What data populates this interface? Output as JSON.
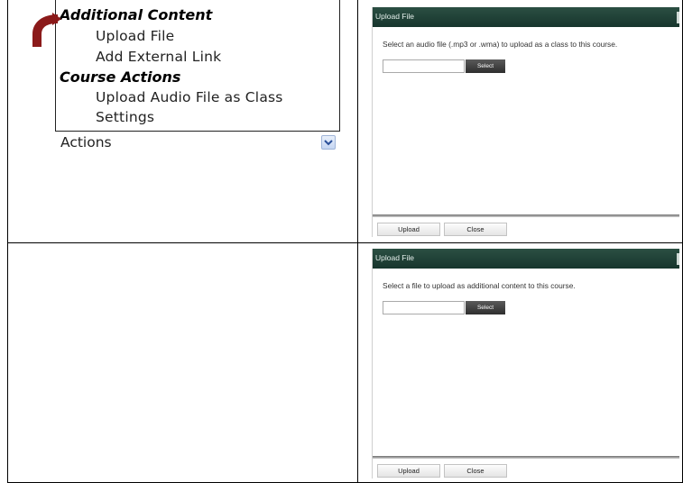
{
  "menu": {
    "additional_content_header": "Additional Content",
    "upload_file": "Upload File",
    "add_external_link": "Add External Link",
    "course_actions_header": "Course Actions",
    "upload_audio_line1": "Upload Audio File as Class",
    "settings": "Settings",
    "actions_select_value": "Actions"
  },
  "dialog_top": {
    "title": "Upload File",
    "instruction": "Select an audio file (.mp3 or .wma) to upload as a class to this course.",
    "select_label": "Select",
    "upload_label": "Upload",
    "close_label": "Close"
  },
  "dialog_bottom": {
    "title": "Upload File",
    "instruction": "Select a file to upload as additional content to this course.",
    "select_label": "Select",
    "upload_label": "Upload",
    "close_label": "Close"
  },
  "colors": {
    "titlebar": "#1f4037",
    "arrow": "#8b1a1a",
    "select_button": "#3a3a3a"
  },
  "icons": {
    "menu_arrow": "curved-arrow-icon",
    "select_chevron": "chevron-down-icon"
  }
}
